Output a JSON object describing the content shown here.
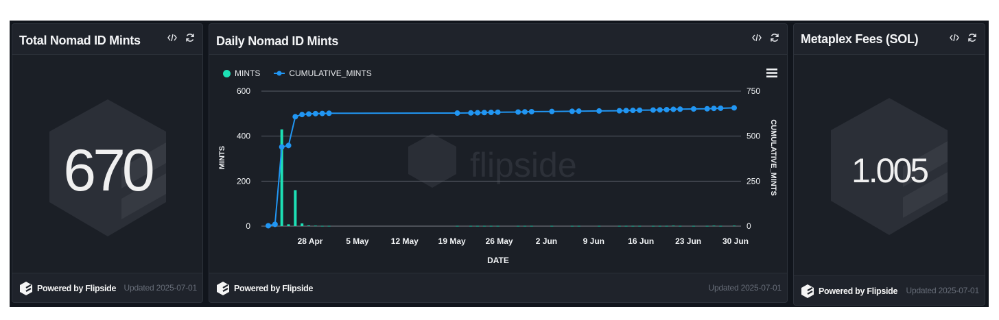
{
  "panels": {
    "total": {
      "title": "Total Nomad ID Mints",
      "value": "670",
      "footer": {
        "powered": "Powered by Flipside",
        "updated": "Updated 2025-07-01"
      }
    },
    "daily": {
      "title": "Daily Nomad ID Mints",
      "watermark": "flipside",
      "footer": {
        "powered": "Powered by Flipside",
        "updated": "Updated 2025-07-01"
      }
    },
    "fees": {
      "title": "Metaplex Fees (SOL)",
      "value": "1.005",
      "footer": {
        "powered": "Powered by Flipside",
        "updated": "Updated 2025-07-01"
      }
    }
  },
  "icons": {
    "code": "code-icon",
    "refresh": "refresh-icon",
    "menu": "hamburger-menu-icon",
    "logo": "flipside-logo-icon"
  },
  "colors": {
    "mints": "#1de0b5",
    "cumulative": "#2196f3",
    "background": "#1b1f26",
    "panel": "#1f232b"
  },
  "chart_data": {
    "type": "bar",
    "xlabel": "DATE",
    "ylabel": "MINTS",
    "y2label": "CUMULATIVE_MINTS",
    "ylim": [
      0,
      600
    ],
    "y2lim": [
      0,
      750
    ],
    "yticks": [
      "0",
      "200",
      "400",
      "600"
    ],
    "y2ticks": [
      "0",
      "250",
      "500",
      "750"
    ],
    "xticks": [
      "28 Apr",
      "5 May",
      "12 May",
      "19 May",
      "26 May",
      "2 Jun",
      "9 Jun",
      "16 Jun",
      "23 Jun",
      "30 Jun"
    ],
    "grid": true,
    "legend": "top-left",
    "series": [
      {
        "name": "MINTS",
        "type": "bar",
        "dates": [
          "2025-04-22",
          "2025-04-23",
          "2025-04-24",
          "2025-04-25",
          "2025-04-26",
          "2025-04-27",
          "2025-04-28",
          "2025-04-29",
          "2025-04-30",
          "2025-05-01",
          "2025-05-20",
          "2025-05-22",
          "2025-05-23",
          "2025-05-24",
          "2025-05-25",
          "2025-05-26",
          "2025-05-29",
          "2025-05-30",
          "2025-05-31",
          "2025-06-03",
          "2025-06-06",
          "2025-06-07",
          "2025-06-10",
          "2025-06-13",
          "2025-06-14",
          "2025-06-15",
          "2025-06-16",
          "2025-06-18",
          "2025-06-19",
          "2025-06-20",
          "2025-06-21",
          "2025-06-22",
          "2025-06-24",
          "2025-06-26",
          "2025-06-27",
          "2025-06-28",
          "2025-06-30"
        ],
        "values": [
          2,
          8,
          430,
          8,
          160,
          12,
          3,
          2,
          1,
          1,
          1,
          1,
          1,
          1,
          1,
          1,
          1,
          1,
          1,
          1,
          1,
          1,
          1,
          1,
          1,
          1,
          1,
          1,
          1,
          1,
          2,
          1,
          1,
          1,
          2,
          1,
          2
        ]
      },
      {
        "name": "CUMULATIVE_MINTS",
        "type": "line",
        "axis": "right",
        "dates": [
          "2025-04-22",
          "2025-04-23",
          "2025-04-24",
          "2025-04-25",
          "2025-04-26",
          "2025-04-27",
          "2025-04-28",
          "2025-04-29",
          "2025-04-30",
          "2025-05-01",
          "2025-05-20",
          "2025-05-22",
          "2025-05-23",
          "2025-05-24",
          "2025-05-25",
          "2025-05-26",
          "2025-05-29",
          "2025-05-30",
          "2025-05-31",
          "2025-06-03",
          "2025-06-06",
          "2025-06-07",
          "2025-06-10",
          "2025-06-13",
          "2025-06-14",
          "2025-06-15",
          "2025-06-16",
          "2025-06-18",
          "2025-06-19",
          "2025-06-20",
          "2025-06-21",
          "2025-06-22",
          "2025-06-24",
          "2025-06-26",
          "2025-06-27",
          "2025-06-28",
          "2025-06-30"
        ],
        "values": [
          2,
          10,
          440,
          448,
          608,
          620,
          623,
          625,
          626,
          627,
          628,
          629,
          630,
          631,
          632,
          633,
          634,
          635,
          636,
          637,
          638,
          639,
          640,
          641,
          642,
          643,
          644,
          645,
          646,
          647,
          649,
          650,
          651,
          652,
          654,
          655,
          657
        ]
      }
    ]
  }
}
